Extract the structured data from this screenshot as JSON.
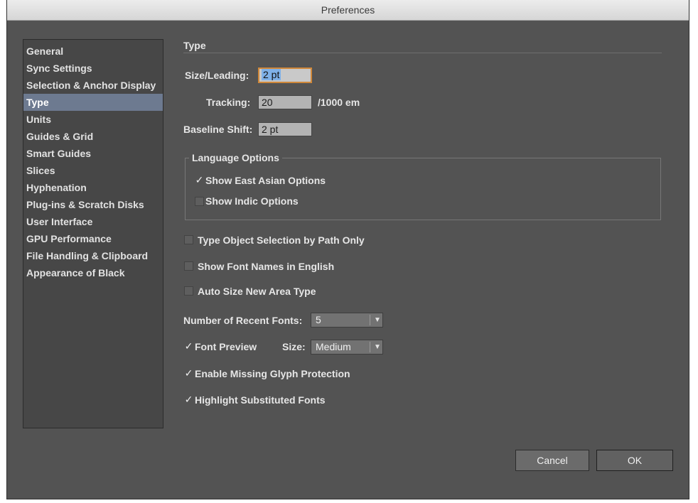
{
  "window": {
    "title": "Preferences"
  },
  "sidebar": {
    "items": [
      {
        "label": "General"
      },
      {
        "label": "Sync Settings"
      },
      {
        "label": "Selection & Anchor Display"
      },
      {
        "label": "Type"
      },
      {
        "label": "Units"
      },
      {
        "label": "Guides & Grid"
      },
      {
        "label": "Smart Guides"
      },
      {
        "label": "Slices"
      },
      {
        "label": "Hyphenation"
      },
      {
        "label": "Plug-ins & Scratch Disks"
      },
      {
        "label": "User Interface"
      },
      {
        "label": "GPU Performance"
      },
      {
        "label": "File Handling & Clipboard"
      },
      {
        "label": "Appearance of Black"
      }
    ],
    "selected": "Type"
  },
  "type_panel": {
    "section_title": "Type",
    "size_leading": {
      "label": "Size/Leading:",
      "value": "2 pt"
    },
    "tracking": {
      "label": "Tracking:",
      "value": "20",
      "unit": "/1000 em"
    },
    "baseline_shift": {
      "label": "Baseline Shift:",
      "value": "2 pt"
    },
    "language_options": {
      "title": "Language Options",
      "show_east_asian": {
        "label": "Show East Asian Options",
        "checked": true,
        "mark": "✓"
      },
      "show_indic": {
        "label": "Show Indic Options",
        "checked": false
      }
    },
    "type_object_selection": {
      "label": "Type Object Selection by Path Only",
      "checked": false
    },
    "show_font_names_english": {
      "label": "Show Font Names in English",
      "checked": false
    },
    "auto_size_area_type": {
      "label": "Auto Size New Area Type",
      "checked": false
    },
    "recent_fonts": {
      "label": "Number of Recent Fonts:",
      "value": "5"
    },
    "font_preview": {
      "label": "Font Preview",
      "checked": true,
      "mark": "✓",
      "size_label": "Size:",
      "size_value": "Medium"
    },
    "missing_glyph": {
      "label": "Enable Missing Glyph Protection",
      "checked": true,
      "mark": "✓"
    },
    "highlight_substituted": {
      "label": "Highlight Substituted Fonts",
      "checked": true,
      "mark": "✓"
    }
  },
  "buttons": {
    "cancel": "Cancel",
    "ok": "OK"
  },
  "colors": {
    "window_bg": "#535353",
    "sidebar_bg": "#474747",
    "selection": "#6d7a90",
    "focus_ring": "#d0883a",
    "text_selection": "#7fb1e8"
  },
  "icons": {
    "checkmark": "checkmark-icon",
    "dropdown": "triangle-down-icon"
  }
}
